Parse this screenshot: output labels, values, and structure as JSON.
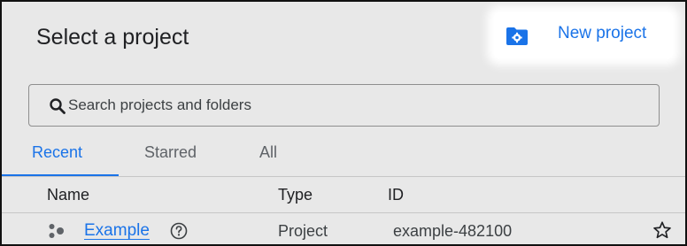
{
  "dialog": {
    "title": "Select a project",
    "new_project_label": "New project"
  },
  "search": {
    "placeholder": "Search projects and folders",
    "value": ""
  },
  "tabs": [
    {
      "label": "Recent",
      "active": true
    },
    {
      "label": "Starred",
      "active": false
    },
    {
      "label": "All",
      "active": false
    }
  ],
  "table": {
    "columns": [
      "Name",
      "Type",
      "ID"
    ],
    "rows": [
      {
        "name": "Example",
        "type": "Project",
        "id": "example-482100",
        "starred": false
      }
    ]
  },
  "icons": {
    "new_project": "folder-settings-icon",
    "search": "search-icon",
    "project": "project-icon",
    "help": "help-circle-icon",
    "star": "star-outline-icon"
  },
  "colors": {
    "accent": "#1a73e8",
    "background": "#e8e8e8",
    "text": "#202124"
  }
}
